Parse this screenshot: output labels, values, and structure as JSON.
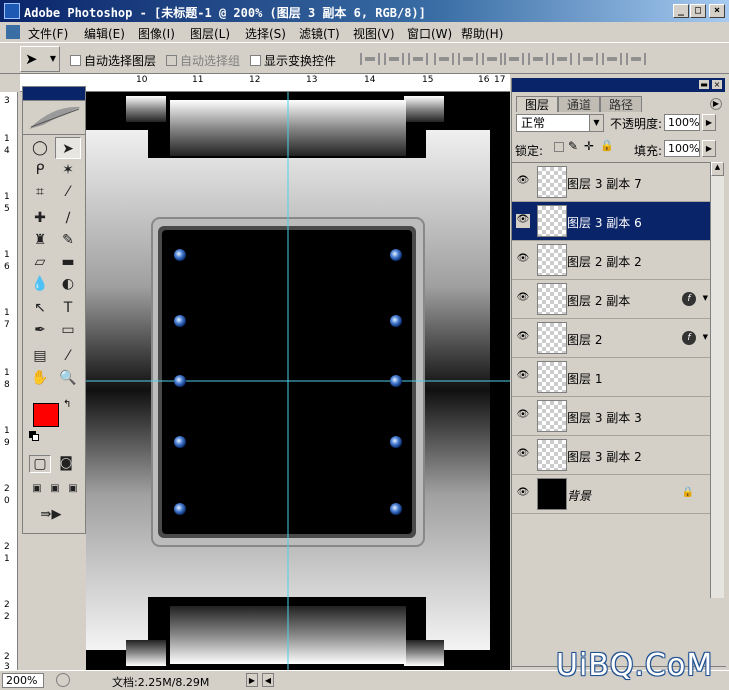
{
  "window": {
    "title": "Adobe Photoshop - [未标题-1 @ 200% (图层 3 副本 6, RGB/8)]",
    "buttons": [
      "_",
      "□",
      "×"
    ]
  },
  "menu": [
    "文件(F)",
    "编辑(E)",
    "图像(I)",
    "图层(L)",
    "选择(S)",
    "滤镜(T)",
    "视图(V)",
    "窗口(W)",
    "帮助(H)"
  ],
  "options": {
    "auto_select_layer": "自动选择图层",
    "auto_select_group": "自动选择组",
    "show_transform": "显示变换控件"
  },
  "ruler_top": [
    "10",
    "11",
    "12",
    "13",
    "14",
    "15",
    "16",
    "17"
  ],
  "ruler_left": [
    "3",
    "1",
    "4",
    "1",
    "5",
    "1",
    "6",
    "1",
    "7",
    "1",
    "8",
    "1",
    "9",
    "2",
    "0",
    "2",
    "1",
    "2",
    "2",
    "2",
    "3"
  ],
  "colors": {
    "foreground": "#ff0000",
    "background": "#ffffff",
    "selection": "#0a246a"
  },
  "layers_panel": {
    "tabs": [
      "图层",
      "通道",
      "路径"
    ],
    "blend_mode": "正常",
    "opacity_label": "不透明度:",
    "opacity": "100%",
    "lock_label": "锁定:",
    "fill_label": "填充:",
    "fill": "100%",
    "layers": [
      {
        "name": "图层 3 副本 7",
        "selected": false,
        "fx": false
      },
      {
        "name": "图层 3 副本 6",
        "selected": true,
        "fx": false
      },
      {
        "name": "图层 2 副本 2",
        "selected": false,
        "fx": false
      },
      {
        "name": "图层 2 副本",
        "selected": false,
        "fx": true
      },
      {
        "name": "图层 2",
        "selected": false,
        "fx": true
      },
      {
        "name": "图层 1",
        "selected": false,
        "fx": false
      },
      {
        "name": "图层 3 副本 3",
        "selected": false,
        "fx": false
      },
      {
        "name": "图层 3 副本 2",
        "selected": false,
        "fx": false
      },
      {
        "name": "背景",
        "selected": false,
        "fx": false,
        "locked": true
      }
    ]
  },
  "status": {
    "zoom": "200%",
    "doc": "文档:2.25M/8.29M"
  },
  "watermark": "UiBQ.CoM"
}
